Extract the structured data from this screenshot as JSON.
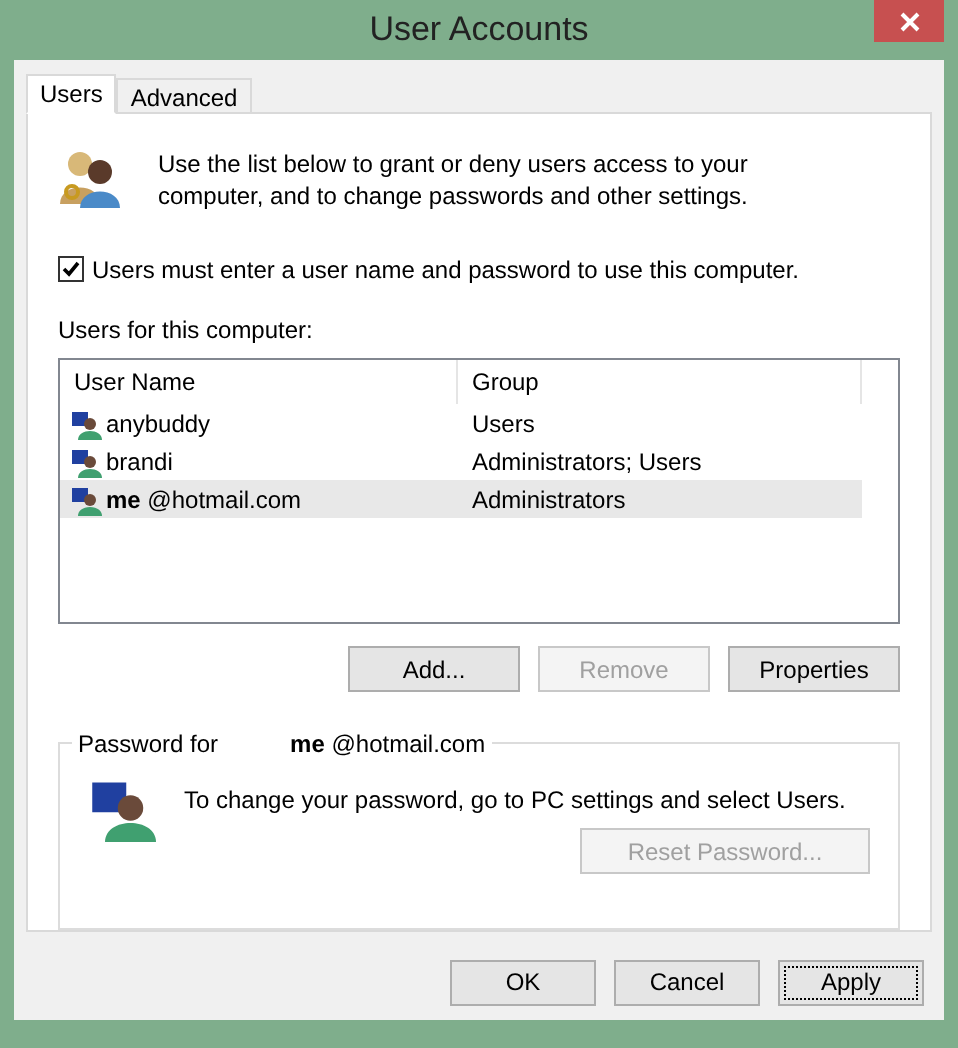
{
  "window": {
    "title": "User Accounts"
  },
  "tabs": [
    {
      "label": "Users",
      "selected": true
    },
    {
      "label": "Advanced",
      "selected": false
    }
  ],
  "intro": "Use the list below to grant or deny users access to your computer, and to change passwords and other settings.",
  "require_password": {
    "label": "Users must enter a user name and password to use this computer.",
    "checked": true
  },
  "users_label": "Users for this computer:",
  "table": {
    "columns": [
      "User Name",
      "Group"
    ],
    "rows": [
      {
        "user": "anybuddy",
        "group": "Users",
        "selected": false
      },
      {
        "user": "brandi",
        "group": "Administrators; Users",
        "selected": false
      },
      {
        "user": "**me** @hotmail.com",
        "group": "Administrators",
        "selected": true
      }
    ]
  },
  "list_buttons": [
    {
      "label": "Add...",
      "disabled": false
    },
    {
      "label": "Remove",
      "disabled": true
    },
    {
      "label": "Properties",
      "disabled": false
    }
  ],
  "password_group": {
    "legend": "Password for",
    "account": "**me** @hotmail.com",
    "message": "To change your password, go to PC settings and select Users.",
    "reset_button": {
      "label": "Reset Password...",
      "disabled": true
    }
  },
  "dialog_buttons": [
    {
      "label": "OK",
      "focused": false
    },
    {
      "label": "Cancel",
      "focused": false
    },
    {
      "label": "Apply",
      "focused": true
    }
  ]
}
